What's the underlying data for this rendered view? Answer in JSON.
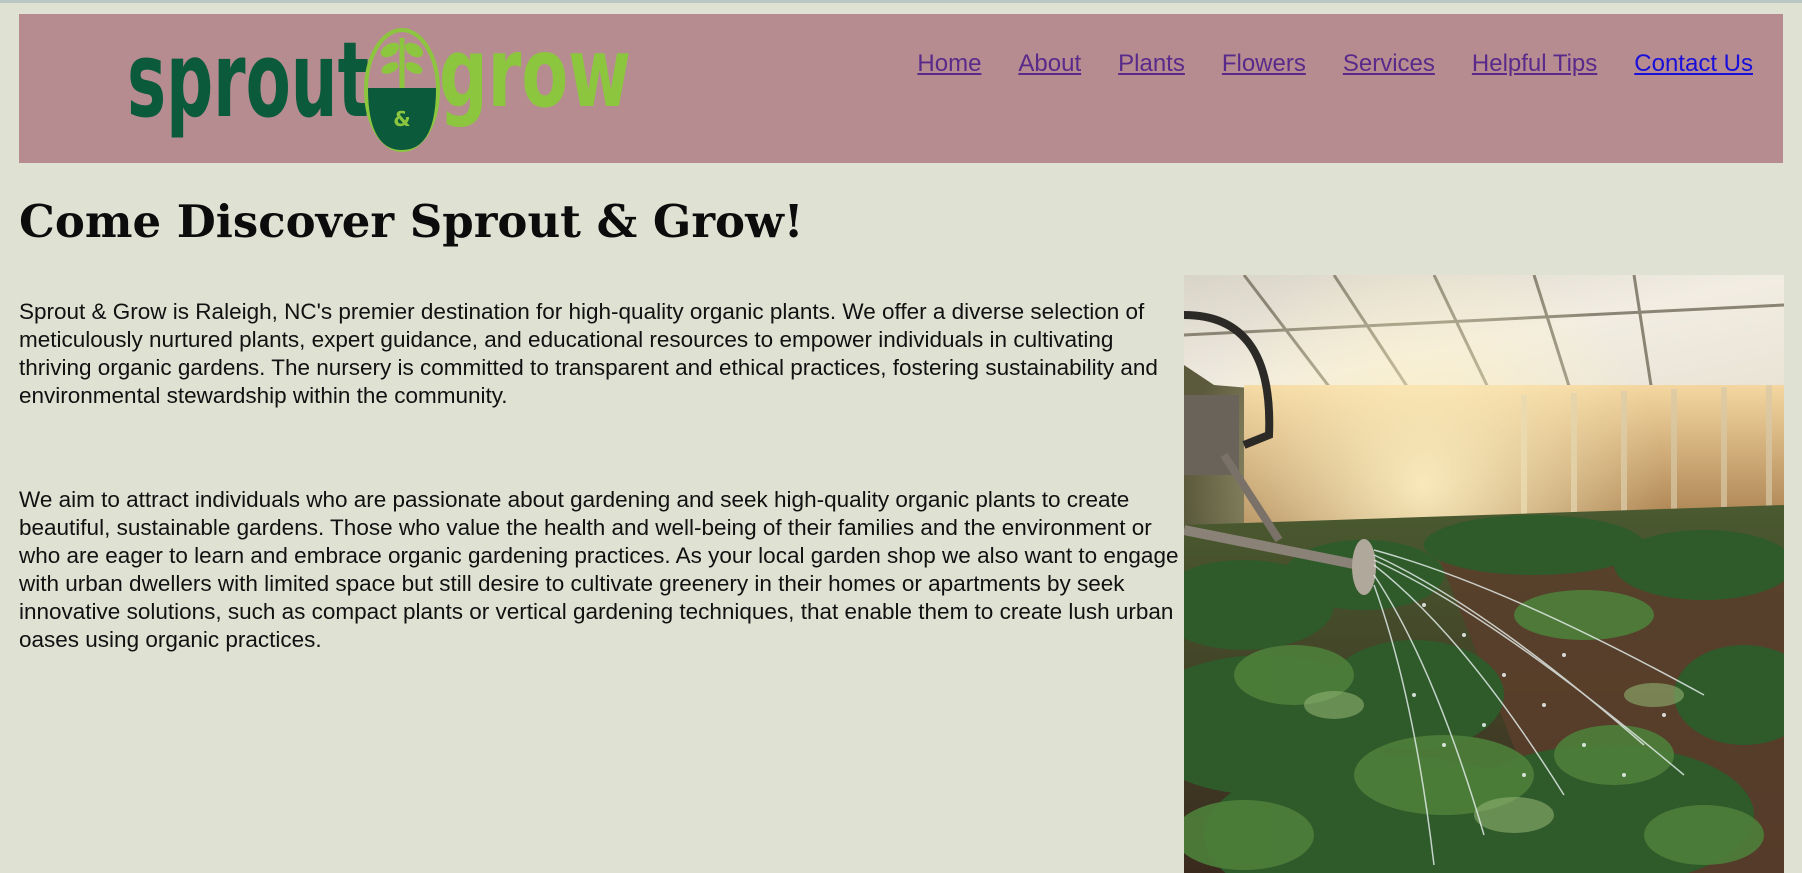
{
  "brand": {
    "logo_word_left": "sprout",
    "logo_word_right": "grow",
    "logo_amp": "&",
    "colors": {
      "dark_green": "#0c5a3c",
      "light_green": "#8cc63f"
    }
  },
  "nav": {
    "items": [
      {
        "label": "Home"
      },
      {
        "label": "About"
      },
      {
        "label": "Plants"
      },
      {
        "label": "Flowers"
      },
      {
        "label": "Services"
      },
      {
        "label": "Helpful Tips"
      },
      {
        "label": "Contact Us"
      }
    ]
  },
  "main": {
    "heading": "Come Discover Sprout & Grow!",
    "paragraphs": [
      "Sprout & Grow is Raleigh, NC's premier destination for high-quality organic plants. We offer a diverse selection of meticulously nurtured plants, expert guidance, and educational resources to empower individuals in cultivating thriving organic gardens. The nursery is committed to transparent and ethical practices, fostering sustainability and environmental stewardship within the community.",
      "We aim to attract individuals who are passionate about gardening and seek high-quality organic plants to create beautiful, sustainable gardens. Those who value the health and well-being of their families and the environment or who are eager to learn and embrace organic gardening practices. As your local garden shop we also want to engage with urban dwellers with limited space but still desire to cultivate greenery in their homes or apartments by seek innovative solutions, such as compact plants or vertical gardening techniques, that enable them to create lush urban oases using organic practices."
    ]
  },
  "colors": {
    "page_bg": "#dfe1d3",
    "header_bg": "#b68c91",
    "nav_link": "#5a2a8a",
    "nav_link_active": "#1a0fd8"
  }
}
